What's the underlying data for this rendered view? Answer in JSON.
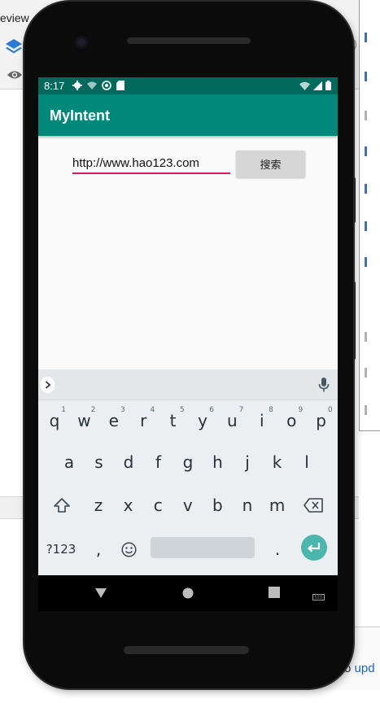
{
  "ide": {
    "preview_label": "eview",
    "notice_text": "o ",
    "notice_link": "upd"
  },
  "status_bar": {
    "time": "8:17"
  },
  "app_bar": {
    "title": "MyIntent"
  },
  "form": {
    "url_value": "http://www.hao123.com",
    "search_label": "搜索"
  },
  "keyboard": {
    "row1": [
      {
        "key": "q",
        "hint": "1"
      },
      {
        "key": "w",
        "hint": "2"
      },
      {
        "key": "e",
        "hint": "3"
      },
      {
        "key": "r",
        "hint": "4"
      },
      {
        "key": "t",
        "hint": "5"
      },
      {
        "key": "y",
        "hint": "6"
      },
      {
        "key": "u",
        "hint": "7"
      },
      {
        "key": "i",
        "hint": "8"
      },
      {
        "key": "o",
        "hint": "9"
      },
      {
        "key": "p",
        "hint": "0"
      }
    ],
    "row2": [
      "a",
      "s",
      "d",
      "f",
      "g",
      "h",
      "j",
      "k",
      "l"
    ],
    "row3": [
      "z",
      "x",
      "c",
      "v",
      "b",
      "n",
      "m"
    ],
    "symbols_label": "?123",
    "comma": ",",
    "period": ".",
    "icons": {
      "expand": "chevron-right-icon",
      "mic": "microphone-icon",
      "shift": "shift-icon",
      "backspace": "backspace-icon",
      "emoji": "emoji-icon",
      "enter": "enter-icon"
    }
  },
  "colors": {
    "status_bar": "#00695c",
    "app_bar": "#00897b",
    "accent": "#d81b60",
    "enter_key": "#4db6ac"
  }
}
